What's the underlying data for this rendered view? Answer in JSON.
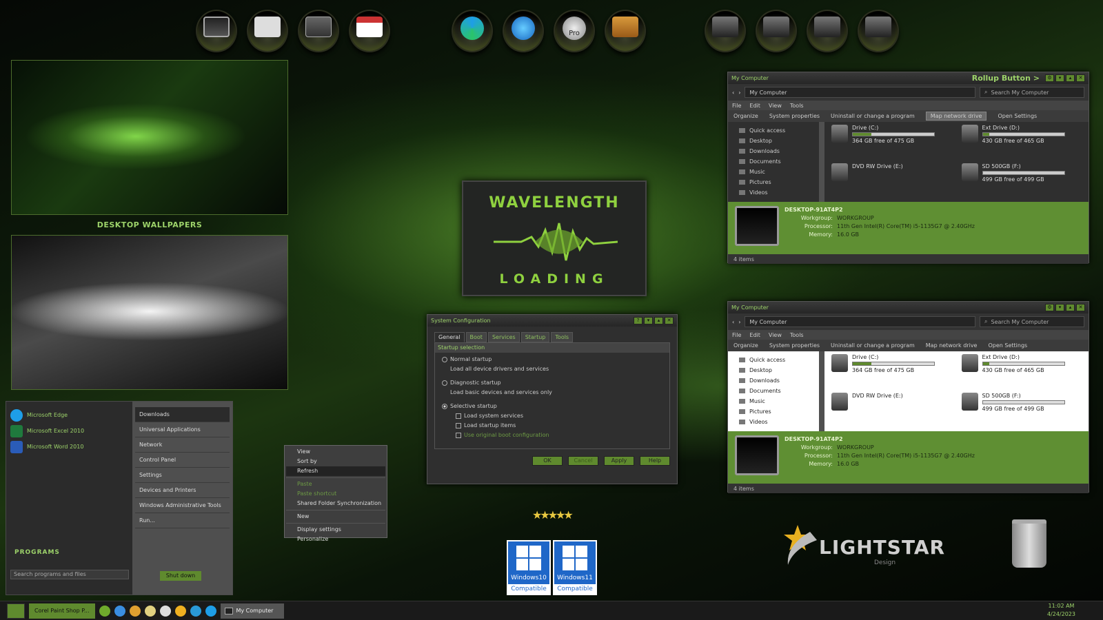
{
  "colors": {
    "accent": "#9dd36a",
    "window_green": "#5f8f33",
    "taskbar": "#1a1a1a"
  },
  "dock": {
    "left": [
      "computer-icon",
      "documents-icon",
      "network-icon",
      "notepad-icon"
    ],
    "center": [
      "edge-icon",
      "outlook-icon",
      "google-earth-pro-icon",
      "address-book-icon"
    ],
    "center_pro_label": "Pro",
    "right": [
      "drive-icon",
      "drive-icon",
      "drive-icon",
      "drive-icon"
    ]
  },
  "wallpapers": {
    "label": "DESKTOP WALLPAPERS"
  },
  "splash": {
    "title": "WAVELENGTH",
    "subtitle": "LOADING"
  },
  "explorer": {
    "title": "My Computer",
    "rollup": "Rollup Button >",
    "path": "My Computer",
    "search": "Search My Computer",
    "menu": [
      "File",
      "Edit",
      "View",
      "Tools"
    ],
    "commands": [
      "Organize",
      "System properties",
      "Uninstall or change a program",
      "Map network drive",
      "Open Settings"
    ],
    "nav": [
      "Quick access",
      "Desktop",
      "Downloads",
      "Documents",
      "Music",
      "Pictures",
      "Videos"
    ],
    "drives": [
      {
        "name": "Drive (C:)",
        "free": "364 GB free of 475 GB",
        "used_pct": 23
      },
      {
        "name": "Ext Drive (D:)",
        "free": "430 GB free of 465 GB",
        "used_pct": 8
      },
      {
        "name": "DVD RW Drive (E:)",
        "free": "",
        "used_pct": 0
      },
      {
        "name": "SD 500GB (F:)",
        "free": "499 GB free of 499 GB",
        "used_pct": 0
      }
    ],
    "pc": {
      "name": "DESKTOP-91AT4P2",
      "workgroup_label": "Workgroup:",
      "workgroup": "WORKGROUP",
      "processor_label": "Processor:",
      "processor": "11th Gen Intel(R) Core(TM) i5-1135G7 @ 2.40GHz",
      "memory_label": "Memory:",
      "memory": "16.0 GB"
    },
    "status": "4 items"
  },
  "sysconfig": {
    "title": "System Configuration",
    "tabs": [
      "General",
      "Boot",
      "Services",
      "Startup",
      "Tools"
    ],
    "group": "Startup selection",
    "normal": "Normal startup",
    "normal_desc": "Load all device drivers and services",
    "diag": "Diagnostic startup",
    "diag_desc": "Load basic devices and services only",
    "selective": "Selective startup",
    "opt1": "Load system services",
    "opt2": "Load startup items",
    "opt3": "Use original boot configuration",
    "buttons": [
      "OK",
      "Cancel",
      "Apply",
      "Help"
    ]
  },
  "start": {
    "pinned": [
      "Microsoft Edge",
      "Microsoft Excel 2010",
      "Microsoft Word 2010"
    ],
    "programs": "PROGRAMS",
    "search": "Search programs and files",
    "right": [
      "Downloads",
      "Universal Applications",
      "Network",
      "Control Panel",
      "Settings",
      "Devices and Printers",
      "Windows Administrative Tools",
      "Run..."
    ],
    "shutdown": "Shut down"
  },
  "context": [
    "View",
    "Sort by",
    "Refresh",
    "Paste",
    "Paste shortcut",
    "Shared Folder Synchronization",
    "New",
    "Display settings",
    "Personalize"
  ],
  "badges": [
    {
      "name": "Windows10",
      "caption": "Compatible"
    },
    {
      "name": "Windows11",
      "caption": "Compatible"
    }
  ],
  "brand": {
    "name": "LIGHTSTAR",
    "sub": "Design"
  },
  "taskbar": {
    "app1": "Corel Paint Shop P...",
    "app2": "My Computer",
    "time": "11:02 AM",
    "date": "4/24/2023"
  }
}
